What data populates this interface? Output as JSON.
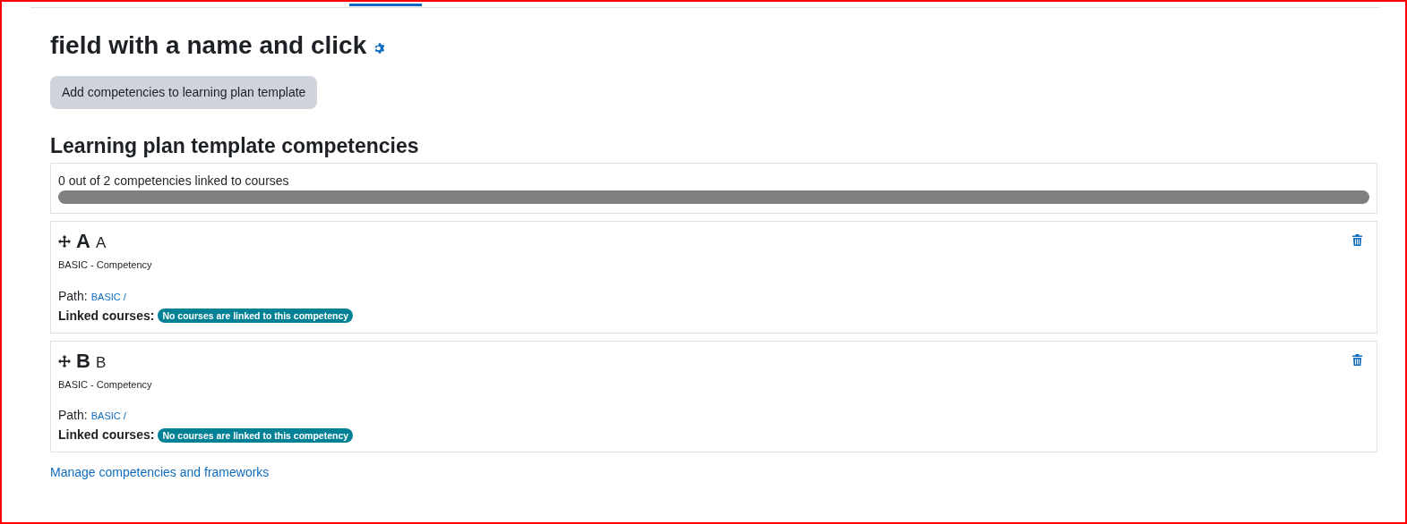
{
  "page_title": "field with a name and click",
  "add_button": "Add competencies to learning plan template",
  "section_heading": "Learning plan template competencies",
  "progress": {
    "text": "0 out of 2 competencies linked to courses",
    "level": 0
  },
  "competencies": [
    {
      "shortname": "A",
      "idnumber": "A",
      "framework": "BASIC - Competency",
      "path_label": "Path:",
      "path_link": "BASIC /",
      "linked_label": "Linked courses:",
      "linked_badge": "No courses are linked to this competency"
    },
    {
      "shortname": "B",
      "idnumber": "B",
      "framework": "BASIC - Competency",
      "path_label": "Path:",
      "path_link": "BASIC /",
      "linked_label": "Linked courses:",
      "linked_badge": "No courses are linked to this competency"
    }
  ],
  "manage_link": "Manage competencies and frameworks"
}
